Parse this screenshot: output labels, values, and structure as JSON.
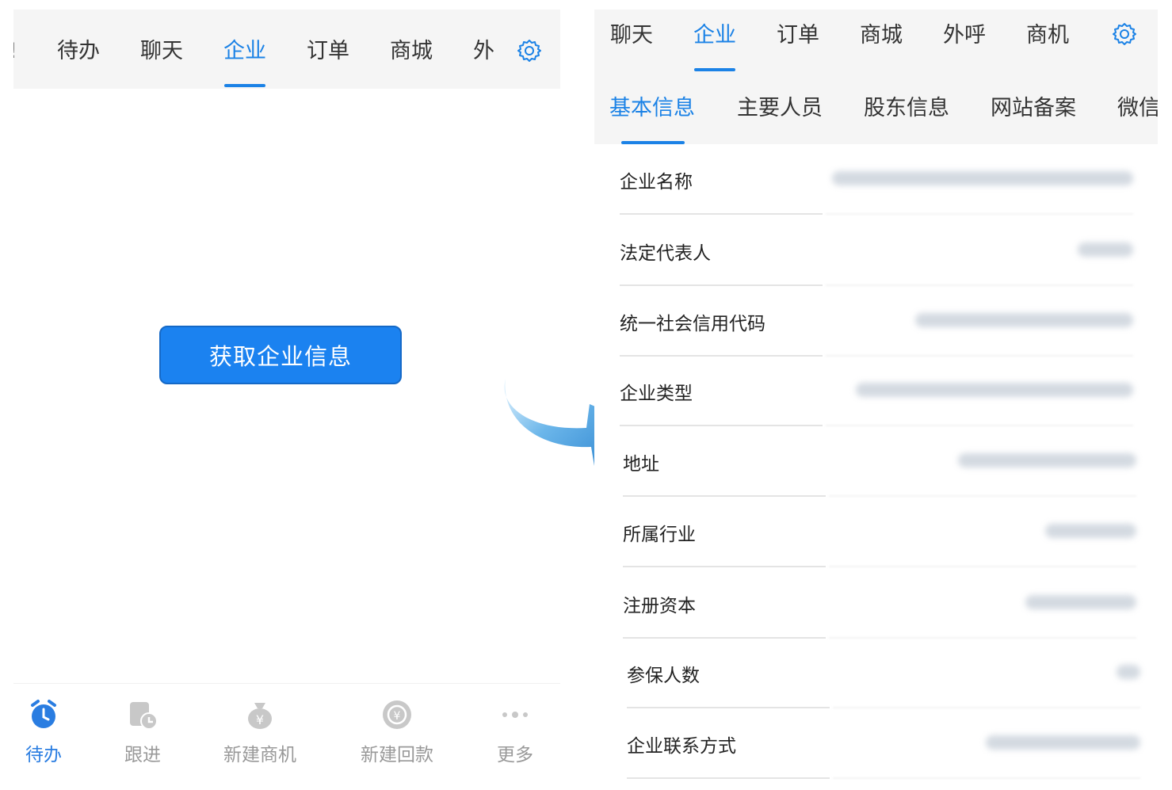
{
  "left": {
    "tabs": [
      {
        "label": "待办",
        "active": false
      },
      {
        "label": "聊天",
        "active": false
      },
      {
        "label": "企业",
        "active": true
      },
      {
        "label": "订单",
        "active": false
      },
      {
        "label": "商城",
        "active": false
      },
      {
        "label": "外",
        "active": false
      }
    ],
    "settings_icon": "gear-icon",
    "fetch_button": "获取企业信息",
    "bottom_nav": [
      {
        "label": "待办",
        "icon": "alarm-clock-icon",
        "active": true
      },
      {
        "label": "跟进",
        "icon": "followup-clock-icon",
        "active": false
      },
      {
        "label": "新建商机",
        "icon": "money-bag-icon",
        "active": false
      },
      {
        "label": "新建回款",
        "icon": "yen-coin-icon",
        "active": false
      },
      {
        "label": "更多",
        "icon": "more-dots-icon",
        "active": false
      }
    ]
  },
  "right": {
    "tabs": [
      {
        "label": "聊天",
        "active": false
      },
      {
        "label": "企业",
        "active": true
      },
      {
        "label": "订单",
        "active": false
      },
      {
        "label": "商城",
        "active": false
      },
      {
        "label": "外呼",
        "active": false
      },
      {
        "label": "商机",
        "active": false
      }
    ],
    "settings_icon": "gear-icon",
    "subtabs": [
      {
        "label": "基本信息",
        "active": true
      },
      {
        "label": "主要人员",
        "active": false
      },
      {
        "label": "股东信息",
        "active": false
      },
      {
        "label": "网站备案",
        "active": false
      },
      {
        "label": "微信",
        "active": false
      }
    ],
    "info_rows": [
      {
        "label": "企业名称"
      },
      {
        "label": "法定代表人"
      },
      {
        "label": "统一社会信用代码"
      },
      {
        "label": "企业类型"
      },
      {
        "label": "地址"
      },
      {
        "label": "所属行业"
      },
      {
        "label": "注册资本"
      },
      {
        "label": "参保人数"
      },
      {
        "label": "企业联系方式"
      }
    ]
  },
  "colors": {
    "accent": "#1b82e6",
    "button": "#1b82f0",
    "tabbar_bg": "#f5f5f5",
    "inactive_text": "#999999"
  },
  "arrow_icon": "curved-arrow-icon"
}
